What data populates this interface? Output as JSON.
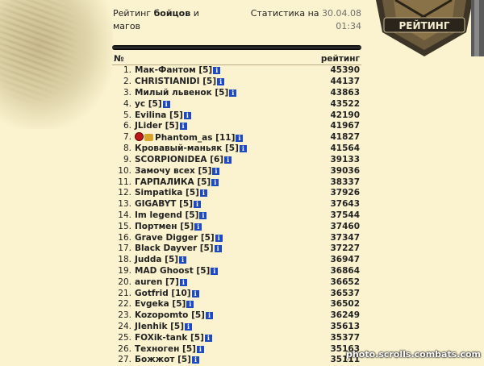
{
  "header": {
    "title_prefix": "Рейтинг ",
    "title_bold": "бойцов",
    "title_suffix": " и магов",
    "stats_label": "Статистика на ",
    "stats_date": "30.04.08",
    "stats_time": "01:34",
    "emblem_text": "РЕЙТИНГ"
  },
  "table": {
    "col_num": "№",
    "col_rating": "рейтинг",
    "rows": [
      {
        "num": "1.",
        "name": "Мак-Фантом",
        "level": "[5]",
        "score": "45390"
      },
      {
        "num": "2.",
        "name": "CHRISTIANIDI",
        "level": "[5]",
        "score": "44137"
      },
      {
        "num": "3.",
        "name": "Милый львенок",
        "level": "[5]",
        "score": "43863"
      },
      {
        "num": "4.",
        "name": "yc",
        "level": "[5]",
        "score": "43522"
      },
      {
        "num": "5.",
        "name": "Evilina",
        "level": "[5]",
        "score": "42190"
      },
      {
        "num": "6.",
        "name": "JLider",
        "level": "[5]",
        "score": "41967"
      },
      {
        "num": "7.",
        "name": "Phantom_as",
        "level": "[11]",
        "score": "41827"
      },
      {
        "num": "8.",
        "name": "Кровавый-маньяк",
        "level": "[5]",
        "score": "41564"
      },
      {
        "num": "9.",
        "name": "SCORPIONIDEA",
        "level": "[6]",
        "score": "39133"
      },
      {
        "num": "10.",
        "name": "Замочу всех",
        "level": "[5]",
        "score": "39036"
      },
      {
        "num": "11.",
        "name": "ГАРПАЛИКА",
        "level": "[5]",
        "score": "38337"
      },
      {
        "num": "12.",
        "name": "Simpatika",
        "level": "[5]",
        "score": "37926"
      },
      {
        "num": "13.",
        "name": "GIGABYT",
        "level": "[5]",
        "score": "37643"
      },
      {
        "num": "14.",
        "name": "Im legend",
        "level": "[5]",
        "score": "37544"
      },
      {
        "num": "15.",
        "name": "Портмен",
        "level": "[5]",
        "score": "37460"
      },
      {
        "num": "16.",
        "name": "Grave Digger",
        "level": "[5]",
        "score": "37347"
      },
      {
        "num": "17.",
        "name": "Black Dayver",
        "level": "[5]",
        "score": "37227"
      },
      {
        "num": "18.",
        "name": "Judda",
        "level": "[5]",
        "score": "36947"
      },
      {
        "num": "19.",
        "name": "MAD Ghoost",
        "level": "[5]",
        "score": "36864"
      },
      {
        "num": "20.",
        "name": "auren",
        "level": "[7]",
        "score": "36652"
      },
      {
        "num": "21.",
        "name": "Gotfrid",
        "level": "[10]",
        "score": "36537"
      },
      {
        "num": "22.",
        "name": "Evgeka",
        "level": "[5]",
        "score": "36502"
      },
      {
        "num": "23.",
        "name": "Kozopomto",
        "level": "[5]",
        "score": "36249"
      },
      {
        "num": "24.",
        "name": "JIenhik",
        "level": "[5]",
        "score": "35613"
      },
      {
        "num": "25.",
        "name": "FOXik-tank",
        "level": "[5]",
        "score": "35377"
      },
      {
        "num": "26.",
        "name": "Техноген",
        "level": "[5]",
        "score": "35163"
      },
      {
        "num": "27.",
        "name": "Божжот",
        "level": "[5]",
        "score": "35111"
      }
    ]
  },
  "watermark": "photo.scrolls.combats.com",
  "icons": {
    "info": "info-icon",
    "clan": "clan-badge-icon",
    "align": "alignment-icon"
  },
  "colors": {
    "background": "#fbf3cf",
    "info_badge": "#1d49c4",
    "date_text": "#6e6e6e"
  }
}
